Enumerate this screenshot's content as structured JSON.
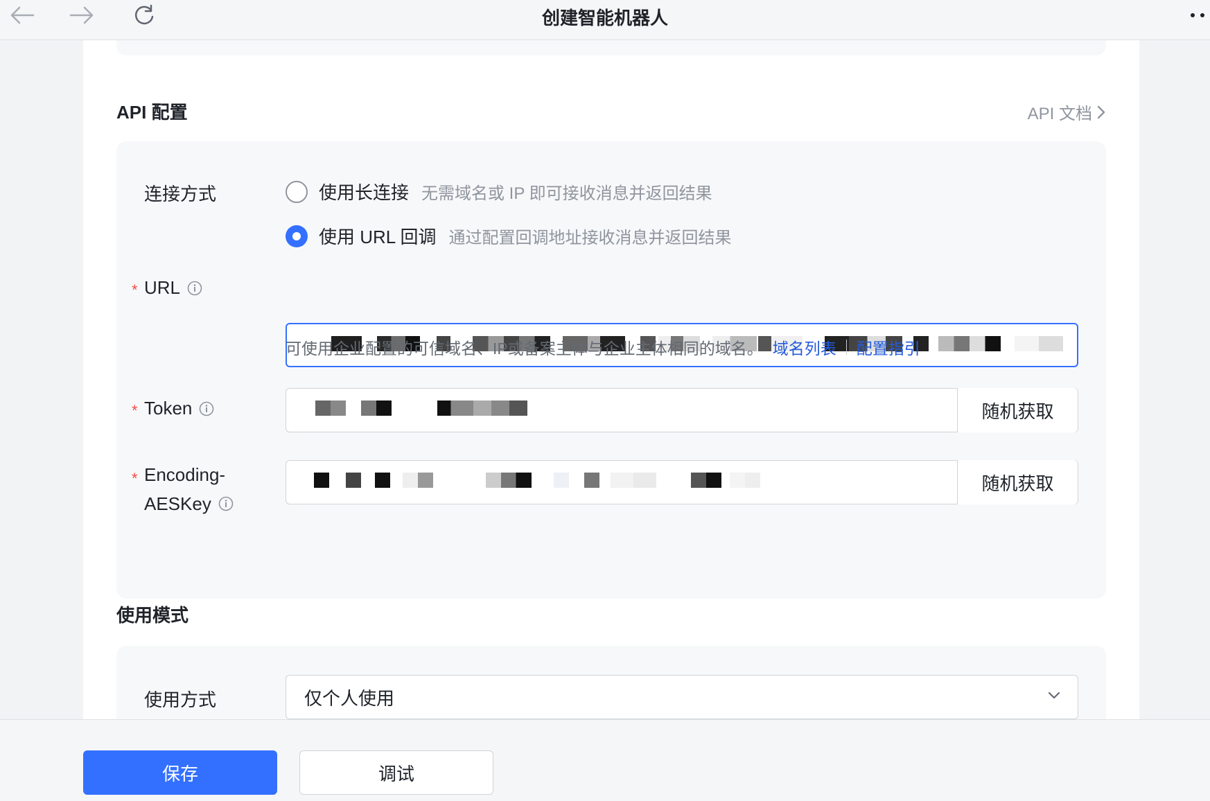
{
  "window": {
    "title": "创建智能机器人"
  },
  "api_section": {
    "title": "API 配置",
    "doc_link": "API 文档",
    "connection": {
      "label": "连接方式",
      "options": [
        {
          "label": "使用长连接",
          "desc": "无需域名或 IP 即可接收消息并返回结果",
          "selected": false
        },
        {
          "label": "使用 URL 回调",
          "desc": "通过配置回调地址接收消息并返回结果",
          "selected": true
        }
      ]
    },
    "url": {
      "label": "URL",
      "value_state": "redacted",
      "hint": "可使用企业配置的可信域名、IP或备案主体与企业主体相同的域名。",
      "links": [
        "域名列表",
        "配置指引"
      ]
    },
    "token": {
      "label": "Token",
      "value_state": "redacted",
      "button": "随机获取"
    },
    "aes_key": {
      "label_line1": "Encoding-",
      "label_line2": "AESKey",
      "value_state": "redacted",
      "button": "随机获取"
    }
  },
  "mode_section": {
    "title": "使用模式",
    "usage": {
      "label": "使用方式",
      "value": "仅个人使用"
    }
  },
  "footer": {
    "save": "保存",
    "debug": "调试"
  },
  "colors": {
    "accent": "#3370ff",
    "link": "#245bdb",
    "required": "#f54a45",
    "muted_text": "#8f959e"
  },
  "icons": [
    "arrow-left-icon",
    "arrow-right-icon",
    "refresh-icon",
    "more-icon",
    "chevron-right-icon",
    "info-icon",
    "chevron-down-icon"
  ]
}
